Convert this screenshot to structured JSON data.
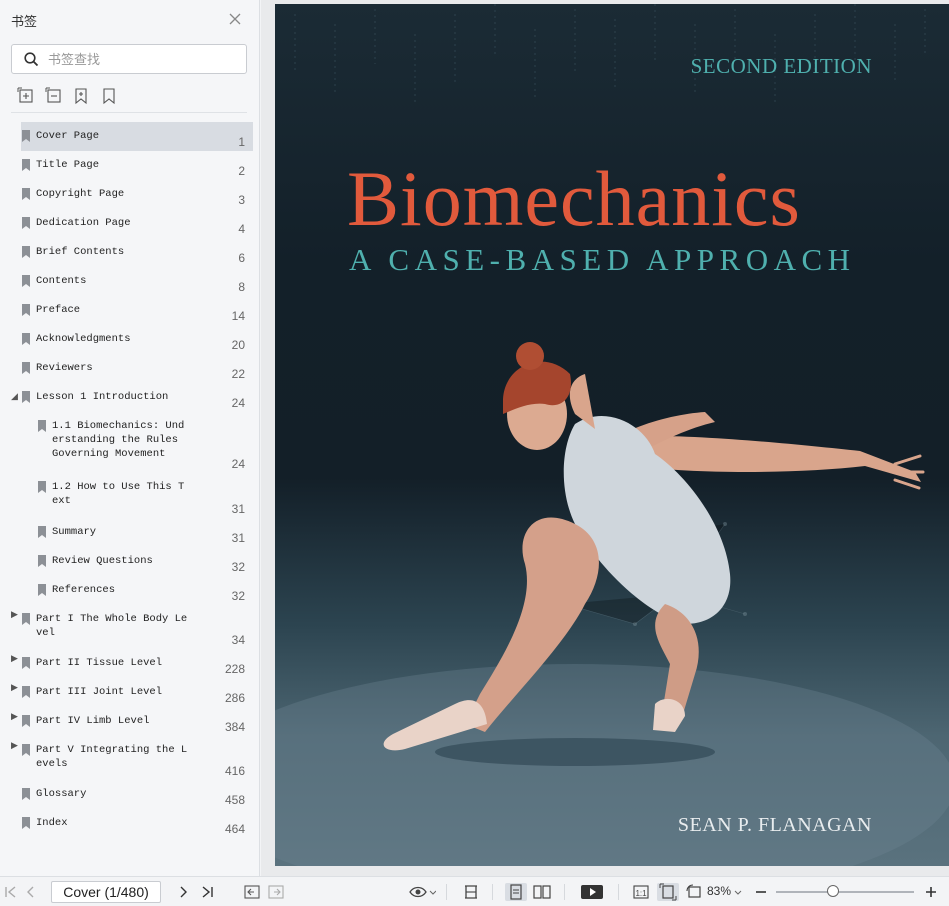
{
  "sidebar": {
    "title": "书签",
    "search_placeholder": "书签查找",
    "bookmarks": [
      {
        "label": "Cover Page",
        "page": "1",
        "selected": true
      },
      {
        "label": "Title Page",
        "page": "2"
      },
      {
        "label": "Copyright Page",
        "page": "3"
      },
      {
        "label": "Dedication Page",
        "page": "4"
      },
      {
        "label": "Brief Contents",
        "page": "6"
      },
      {
        "label": "Contents",
        "page": "8"
      },
      {
        "label": "Preface",
        "page": "14"
      },
      {
        "label": "Acknowledgments",
        "page": "20"
      },
      {
        "label": "Reviewers",
        "page": "22"
      },
      {
        "label": "Lesson 1 Introduction",
        "page": "24",
        "expanded": true
      },
      {
        "label": "1.1 Biomechanics: Und\nerstanding the Rules\nGoverning Movement",
        "page": "24",
        "child": true
      },
      {
        "label": "1.2 How to Use This T\next",
        "page": "31",
        "child": true
      },
      {
        "label": "Summary",
        "page": "31",
        "child": true
      },
      {
        "label": "Review Questions",
        "page": "32",
        "child": true
      },
      {
        "label": "References",
        "page": "32",
        "child": true
      },
      {
        "label": "Part I The Whole Body Le\nvel",
        "page": "34",
        "collapsed": true
      },
      {
        "label": "Part II Tissue Level",
        "page": "228",
        "collapsed": true
      },
      {
        "label": "Part III Joint Level",
        "page": "286",
        "collapsed": true
      },
      {
        "label": "Part IV Limb Level",
        "page": "384",
        "collapsed": true
      },
      {
        "label": "Part V Integrating the L\nevels",
        "page": "416",
        "collapsed": true
      },
      {
        "label": "Glossary",
        "page": "458"
      },
      {
        "label": "Index",
        "page": "464"
      }
    ]
  },
  "cover": {
    "edition": "SECOND EDITION",
    "title": "Biomechanics",
    "subtitle": "A CASE-BASED APPROACH",
    "author": "SEAN P. FLANAGAN"
  },
  "toolbar": {
    "page_indicator": "Cover (1/480)",
    "zoom": "83%",
    "zoom_level": 0.83
  },
  "colors": {
    "accent_teal": "#4fb0ae",
    "title_orange": "#e15a3c",
    "cover_dark": "#132029"
  }
}
